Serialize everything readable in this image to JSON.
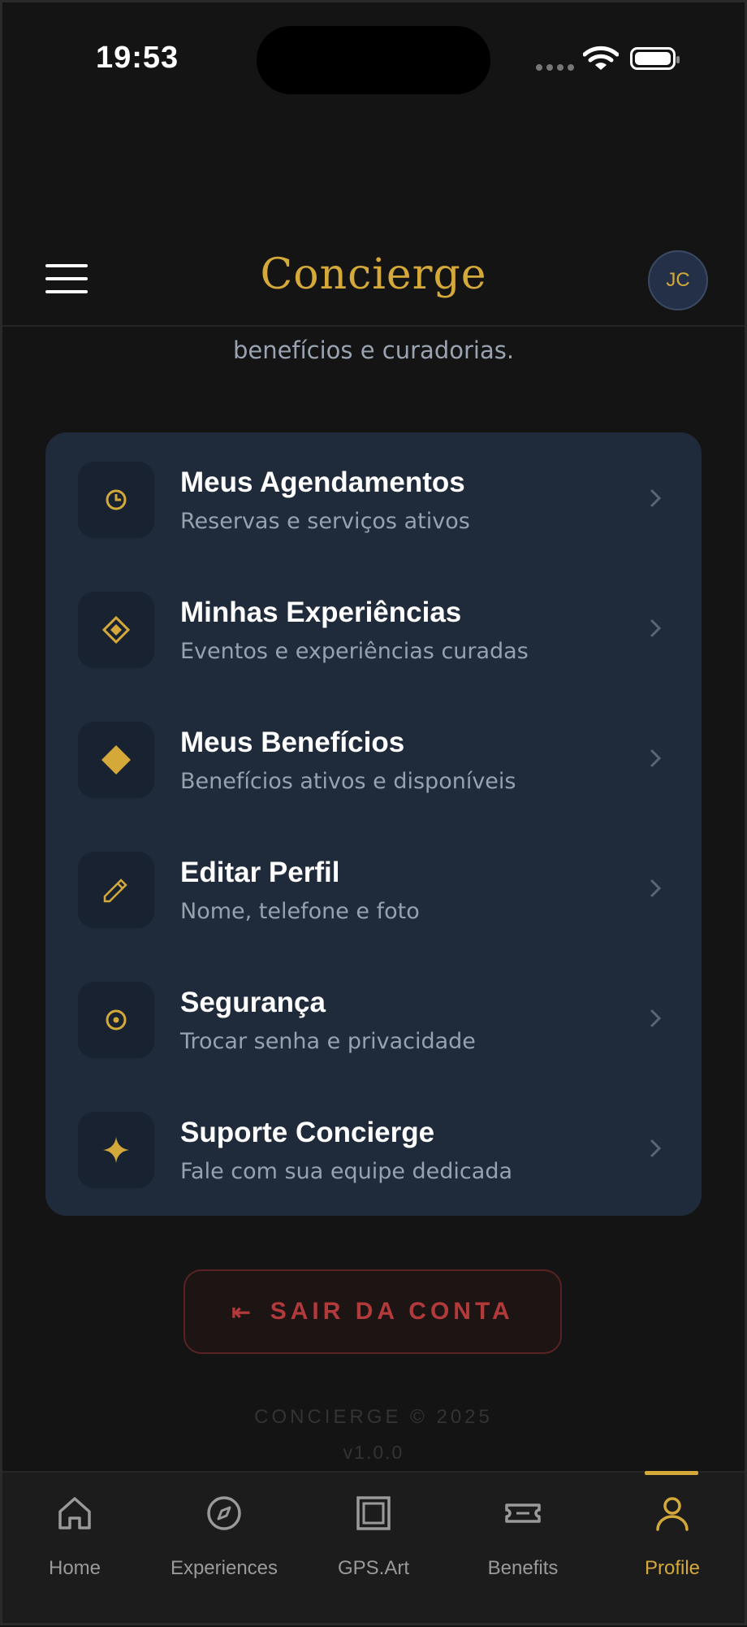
{
  "status_bar": {
    "time": "19:53"
  },
  "header": {
    "brand": "Concierge",
    "avatar_initials": "JC"
  },
  "intro": {
    "text_tail": "benefícios e curadorias."
  },
  "menu": {
    "items": [
      {
        "icon": "clock-icon",
        "title": "Meus Agendamentos",
        "subtitle": "Reservas e serviços ativos"
      },
      {
        "icon": "diamond-outline-icon",
        "title": "Minhas Experiências",
        "subtitle": "Eventos e experiências curadas"
      },
      {
        "icon": "diamond-filled-icon",
        "title": "Meus Benefícios",
        "subtitle": "Benefícios ativos e disponíveis"
      },
      {
        "icon": "pencil-icon",
        "title": "Editar Perfil",
        "subtitle": "Nome, telefone e foto"
      },
      {
        "icon": "target-icon",
        "title": "Segurança",
        "subtitle": "Trocar senha e privacidade"
      },
      {
        "icon": "sparkle-icon",
        "title": "Suporte Concierge",
        "subtitle": "Fale com sua equipe dedicada"
      }
    ]
  },
  "logout": {
    "label": "SAIR DA CONTA",
    "icon": "logout-arrow-icon"
  },
  "footer": {
    "brand": "CONCIERGE © 2025",
    "version": "v1.0.0"
  },
  "tabbar": {
    "tabs": [
      {
        "label": "Home",
        "icon": "home-icon"
      },
      {
        "label": "Experiences",
        "icon": "compass-icon"
      },
      {
        "label": "GPS.Art",
        "icon": "frame-icon"
      },
      {
        "label": "Benefits",
        "icon": "ticket-icon"
      },
      {
        "label": "Profile",
        "icon": "person-icon",
        "active": true
      }
    ]
  },
  "colors": {
    "accent": "#d4a93a",
    "card": "#1f2a3a",
    "background": "#141414",
    "danger": "#b23a3a"
  }
}
